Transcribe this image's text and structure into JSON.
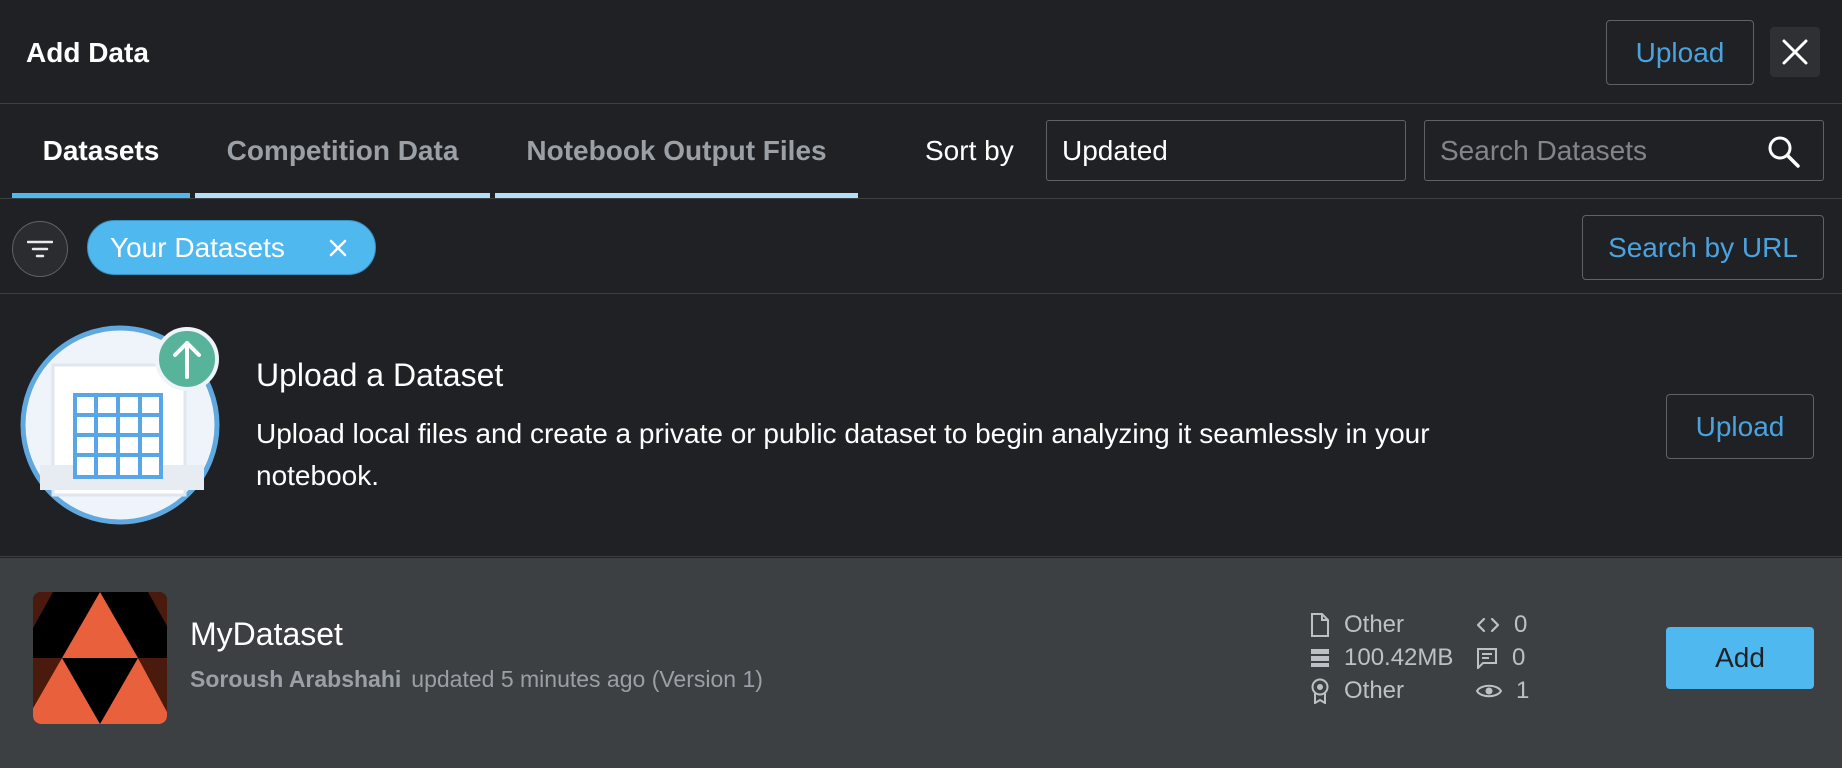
{
  "header": {
    "title": "Add Data",
    "upload_label": "Upload"
  },
  "tabs": [
    {
      "label": "Datasets",
      "active": true
    },
    {
      "label": "Competition Data",
      "active": false
    },
    {
      "label": "Notebook Output Files",
      "active": false
    }
  ],
  "sort": {
    "label": "Sort by",
    "value": "Updated"
  },
  "search": {
    "placeholder": "Search Datasets"
  },
  "filters": {
    "chip_label": "Your Datasets",
    "search_by_url_label": "Search by URL"
  },
  "upload_section": {
    "title": "Upload a Dataset",
    "description": "Upload local files and create a private or public dataset to begin analyzing it seamlessly in your notebook.",
    "button_label": "Upload"
  },
  "dataset": {
    "name": "MyDataset",
    "owner": "Soroush Arabshahi",
    "updated": "updated 5 minutes ago (Version 1)",
    "file_type": "Other",
    "size": "100.42MB",
    "license": "Other",
    "code_count": "0",
    "comment_count": "0",
    "view_count": "1",
    "add_label": "Add"
  },
  "colors": {
    "accent": "#4fb8ef",
    "link": "#4aa3df",
    "background": "#202124",
    "row_background": "#3c4043",
    "thumb_orange": "#e8603c"
  }
}
